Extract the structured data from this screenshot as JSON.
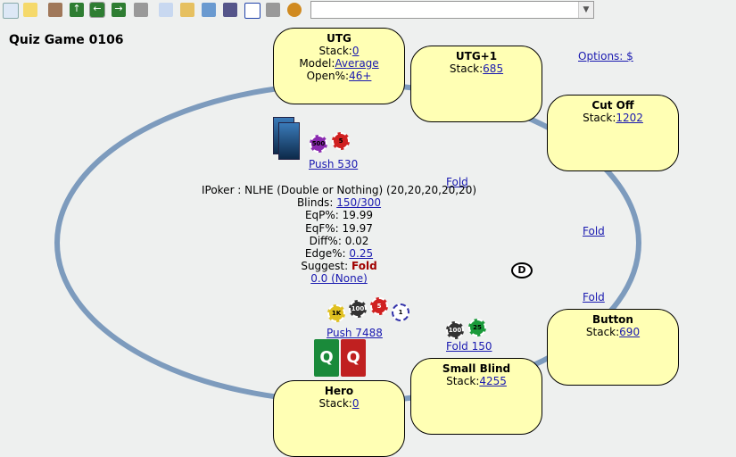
{
  "toolbar": {
    "icons": [
      "new-file-icon",
      "open-folder-icon",
      "home-icon",
      "up-arrow-icon",
      "back-arrow-icon",
      "forward-arrow-icon",
      "stop-icon",
      "copy-icon",
      "paste-icon",
      "image-icon",
      "calculator-icon",
      "chart-icon",
      "flag-icon",
      "settings-icon"
    ],
    "dropdown_value": ""
  },
  "title": "Quiz Game 0106",
  "options_link": "Options: $",
  "seats": {
    "utg": {
      "name": "UTG",
      "stack_label": "Stack:",
      "stack": "0",
      "model_label": "Model:",
      "model": "Average",
      "open_label": "Open%:",
      "open": "46+"
    },
    "utg1": {
      "name": "UTG+1",
      "stack_label": "Stack:",
      "stack": "685"
    },
    "cutoff": {
      "name": "Cut Off",
      "stack_label": "Stack:",
      "stack": "1202"
    },
    "button": {
      "name": "Button",
      "stack_label": "Stack:",
      "stack": "690"
    },
    "sb": {
      "name": "Small Blind",
      "stack_label": "Stack:",
      "stack": "4255"
    },
    "hero": {
      "name": "Hero",
      "stack_label": "Stack:",
      "stack": "0"
    }
  },
  "actions": {
    "utg": "Push 530",
    "utg1": "Fold",
    "cutoff": "Fold",
    "button": "Fold",
    "sb": "Fold 150",
    "hero": "Push 7488"
  },
  "chips": {
    "utg": [
      "500",
      "5"
    ],
    "hero": [
      "1K",
      "100",
      "5",
      "1"
    ],
    "sb": [
      "100",
      "25"
    ]
  },
  "dealer": "D",
  "hero_cards": [
    "Q",
    "Q"
  ],
  "info": {
    "game": "IPoker : NLHE (Double or Nothing) (20,20,20,20,20)",
    "blinds_label": "Blinds:",
    "blinds": "150/300",
    "eqp_label": "EqP%:",
    "eqp": "19.99",
    "eqf_label": "EqF%:",
    "eqf": "19.97",
    "diff_label": "Diff%:",
    "diff": "0.02",
    "edge_label": "Edge%:",
    "edge": "0.25",
    "suggest_label": "Suggest:",
    "suggest": "Fold",
    "extra": "0.0 (None)"
  },
  "colors": {
    "table_rail": "#7d9bbd",
    "seat_fill": "#ffffb4",
    "suggest": "#a00000",
    "link": "#1a1ab0"
  }
}
